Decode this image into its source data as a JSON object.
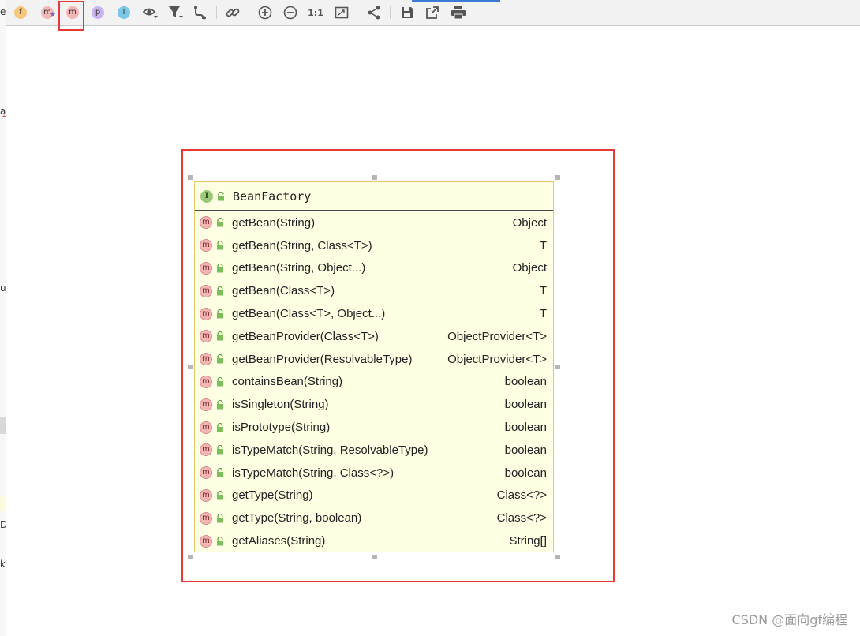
{
  "gutter": {
    "glyphs": [
      "e",
      "a",
      "u",
      "D",
      "k"
    ]
  },
  "toolbar": {
    "fields_icon": "f",
    "inherited_icon": "m",
    "methods_icon": "m",
    "properties_icon": "p",
    "inner_icon": "I",
    "actual_size_label": "1:1"
  },
  "node": {
    "icon": "I",
    "title": "BeanFactory",
    "methods": [
      {
        "icon": "m",
        "name": "getBean(String)",
        "type": "Object"
      },
      {
        "icon": "m",
        "name": "getBean(String, Class<T>)",
        "type": "T"
      },
      {
        "icon": "m",
        "name": "getBean(String, Object...)",
        "type": "Object"
      },
      {
        "icon": "m",
        "name": "getBean(Class<T>)",
        "type": "T"
      },
      {
        "icon": "m",
        "name": "getBean(Class<T>, Object...)",
        "type": "T"
      },
      {
        "icon": "m",
        "name": "getBeanProvider(Class<T>)",
        "type": "ObjectProvider<T>"
      },
      {
        "icon": "m",
        "name": "getBeanProvider(ResolvableType)",
        "type": "ObjectProvider<T>"
      },
      {
        "icon": "m",
        "name": "containsBean(String)",
        "type": "boolean"
      },
      {
        "icon": "m",
        "name": "isSingleton(String)",
        "type": "boolean"
      },
      {
        "icon": "m",
        "name": "isPrototype(String)",
        "type": "boolean"
      },
      {
        "icon": "m",
        "name": "isTypeMatch(String, ResolvableType)",
        "type": "boolean"
      },
      {
        "icon": "m",
        "name": "isTypeMatch(String, Class<?>)",
        "type": "boolean"
      },
      {
        "icon": "m",
        "name": "getType(String)",
        "type": "Class<?>"
      },
      {
        "icon": "m",
        "name": "getType(String, boolean)",
        "type": "Class<?>"
      },
      {
        "icon": "m",
        "name": "getAliases(String)",
        "type": "String[]"
      }
    ]
  },
  "watermark": "CSDN @面向gf编程"
}
